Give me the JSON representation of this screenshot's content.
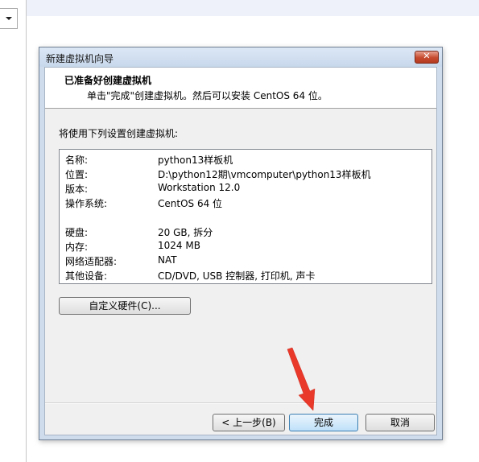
{
  "dialog": {
    "title": "新建虚拟机向导",
    "close_glyph": "✕",
    "header_title": "已准备好创建虚拟机",
    "header_subtitle": "单击\"完成\"创建虚拟机。然后可以安装 CentOS 64 位。",
    "intro": "将使用下列设置创建虚拟机:",
    "summary": [
      {
        "key": "名称:",
        "value": "python13样板机"
      },
      {
        "key": "位置:",
        "value": "D:\\python12期\\vmcomputer\\python13样板机"
      },
      {
        "key": "版本:",
        "value": "Workstation 12.0"
      },
      {
        "key": "操作系统:",
        "value": "CentOS 64 位"
      },
      {
        "key": "硬盘:",
        "value": "20 GB, 拆分"
      },
      {
        "key": "内存:",
        "value": "1024 MB"
      },
      {
        "key": "网络适配器:",
        "value": "NAT"
      },
      {
        "key": "其他设备:",
        "value": "CD/DVD, USB 控制器, 打印机, 声卡"
      }
    ],
    "customize_button": "自定义硬件(C)...",
    "back_button": "< 上一步(B)",
    "finish_button": "完成",
    "cancel_button": "取消"
  },
  "colors": {
    "annotation_arrow": "#e8392b",
    "close_button": "#c64a2e",
    "finish_border": "#3c7fb1"
  },
  "icons": {
    "close": "close-icon",
    "combo": "chevron-down-icon"
  }
}
